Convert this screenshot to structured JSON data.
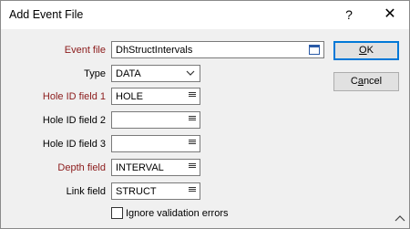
{
  "window": {
    "title": "Add Event File",
    "help_glyph": "?",
    "close_glyph": "✕"
  },
  "form": {
    "event_file": {
      "label": "Event file",
      "value": "DhStructIntervals"
    },
    "type": {
      "label": "Type",
      "value": "DATA"
    },
    "hole_id_1": {
      "label": "Hole ID field 1",
      "value": "HOLE"
    },
    "hole_id_2": {
      "label": "Hole ID field 2",
      "value": ""
    },
    "hole_id_3": {
      "label": "Hole ID field 3",
      "value": ""
    },
    "depth": {
      "label": "Depth field",
      "value": "INTERVAL"
    },
    "link": {
      "label": "Link field",
      "value": "STRUCT"
    },
    "ignore_errors": {
      "label": "Ignore validation errors",
      "checked": false
    }
  },
  "buttons": {
    "ok": {
      "accel": "O",
      "rest": "K"
    },
    "cancel": {
      "pre": "C",
      "accel": "a",
      "rest": "ncel"
    }
  },
  "colors": {
    "required_label": "#8b1a1a",
    "default_button_border": "#0078d7"
  }
}
